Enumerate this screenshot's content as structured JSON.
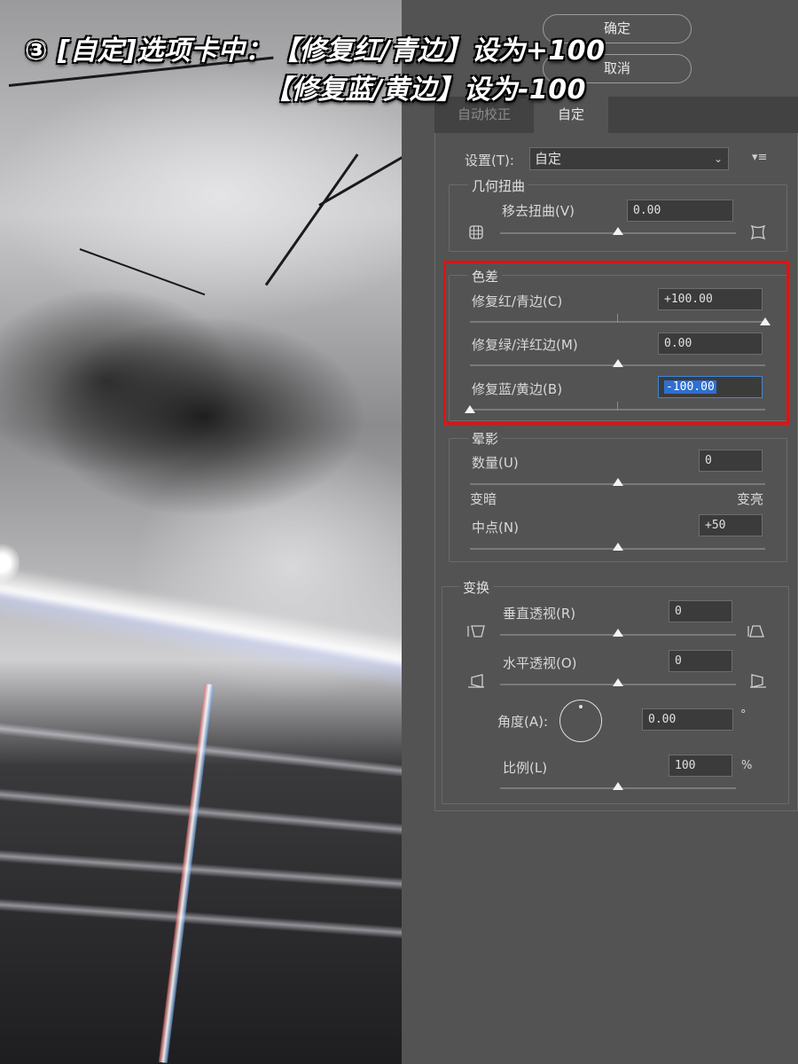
{
  "caption": {
    "line1": "③ [自定]选项卡中：【修复红/青边】设为+100",
    "line2": "【修复蓝/黄边】设为-100"
  },
  "dialog": {
    "ok_label": "确定",
    "cancel_label": "取消"
  },
  "tabs": [
    {
      "label": "自动校正",
      "active": false
    },
    {
      "label": "自定",
      "active": true
    }
  ],
  "settings": {
    "label": "设置(T):",
    "value": "自定"
  },
  "geometric": {
    "title": "几何扭曲",
    "remove_distortion_label": "移去扭曲(V)",
    "remove_distortion_value": "0.00"
  },
  "chromatic": {
    "title": "色差",
    "fix_red_cyan_label": "修复红/青边(C)",
    "fix_red_cyan_value": "+100.00",
    "fix_red_cyan_level": 1.0,
    "fix_green_magenta_label": "修复绿/洋红边(M)",
    "fix_green_magenta_value": "0.00",
    "fix_green_magenta_level": 0.5,
    "fix_blue_yellow_label": "修复蓝/黄边(B)",
    "fix_blue_yellow_value": "-100.00",
    "fix_blue_yellow_level": 0.0
  },
  "vignette": {
    "title": "晕影",
    "amount_label": "数量(U)",
    "amount_value": "0",
    "darken_label": "变暗",
    "lighten_label": "变亮",
    "midpoint_label": "中点(N)",
    "midpoint_value": "+50"
  },
  "transform": {
    "title": "变换",
    "vertical_label": "垂直透视(R)",
    "vertical_value": "0",
    "horizontal_label": "水平透视(O)",
    "horizontal_value": "0",
    "angle_label": "角度(A):",
    "angle_value": "0.00",
    "angle_unit": "°",
    "scale_label": "比例(L)",
    "scale_value": "100",
    "scale_unit": "%"
  },
  "colors": {
    "panel_bg": "#535353",
    "field_bg": "#3b3b3b",
    "highlight_box": "#e01212",
    "selection": "#2f6fd0"
  }
}
